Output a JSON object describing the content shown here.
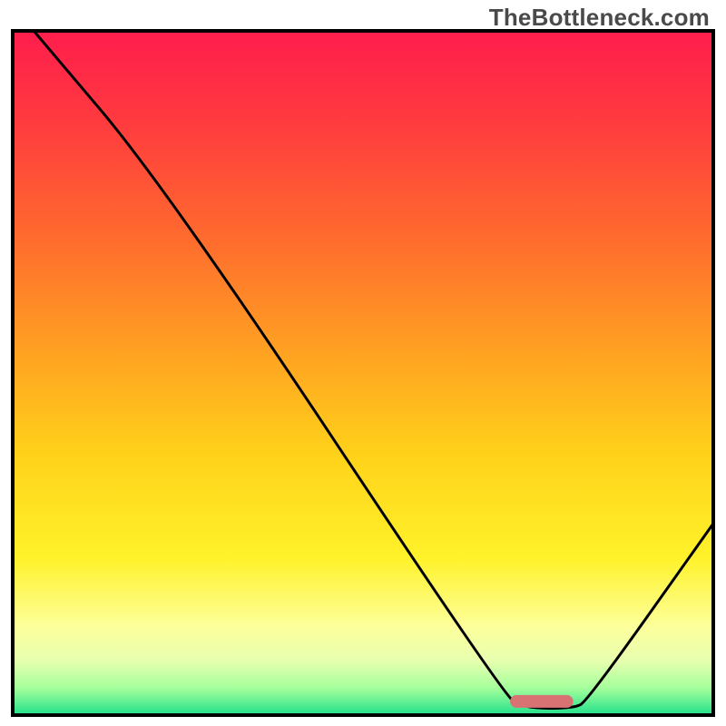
{
  "watermark": "TheBottleneck.com",
  "chart_data": {
    "type": "line",
    "title": "",
    "xlabel": "",
    "ylabel": "",
    "xlim": [
      0,
      100
    ],
    "ylim": [
      0,
      100
    ],
    "legend": false,
    "curve_points": [
      {
        "x": 3,
        "y": 100
      },
      {
        "x": 22,
        "y": 77
      },
      {
        "x": 70,
        "y": 3
      },
      {
        "x": 73,
        "y": 1
      },
      {
        "x": 80,
        "y": 1
      },
      {
        "x": 82,
        "y": 2
      },
      {
        "x": 100,
        "y": 28
      }
    ],
    "marker": {
      "x_start": 71,
      "x_end": 80,
      "y": 2
    },
    "gradient_stops": [
      {
        "pos": 0.0,
        "color": "#ff1d4d"
      },
      {
        "pos": 0.13,
        "color": "#ff3a3f"
      },
      {
        "pos": 0.3,
        "color": "#ff6a2e"
      },
      {
        "pos": 0.48,
        "color": "#ffa521"
      },
      {
        "pos": 0.62,
        "color": "#ffd21a"
      },
      {
        "pos": 0.77,
        "color": "#fff22a"
      },
      {
        "pos": 0.87,
        "color": "#fdff9a"
      },
      {
        "pos": 0.92,
        "color": "#e8ffb0"
      },
      {
        "pos": 0.96,
        "color": "#a6ff9c"
      },
      {
        "pos": 1.0,
        "color": "#21e08b"
      }
    ],
    "frame_color": "#000000",
    "curve_color": "#000000",
    "marker_color": "#d97373"
  }
}
